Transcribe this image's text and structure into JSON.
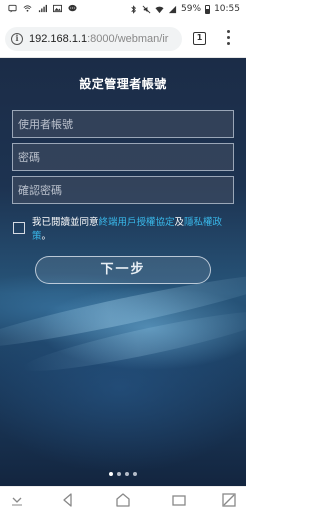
{
  "status_bar": {
    "time": "10:55",
    "battery": "59%"
  },
  "browser": {
    "url_host": "192.168.1.1",
    "url_path": ":8000/webman/ir",
    "tab_count": "1"
  },
  "form": {
    "title": "設定管理者帳號",
    "username_placeholder": "使用者帳號",
    "password_placeholder": "密碼",
    "confirm_placeholder": "確認密碼",
    "agree_prefix": "我已閱讀並同意",
    "eula_link": "終端用戶授權協定",
    "agree_and": "及",
    "privacy_link": "隱私權政策",
    "agree_suffix": "。",
    "next_label": "下一步"
  },
  "pagination": {
    "count": 4,
    "active": 0
  }
}
